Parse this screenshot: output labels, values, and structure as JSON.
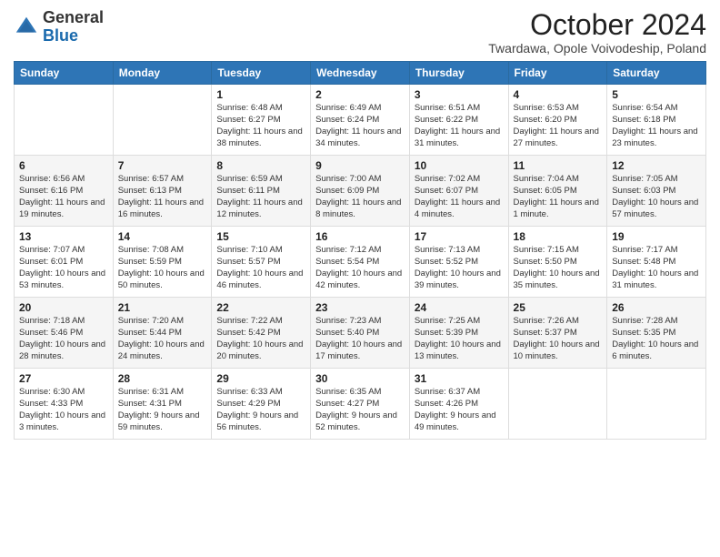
{
  "header": {
    "logo_general": "General",
    "logo_blue": "Blue",
    "month_title": "October 2024",
    "subtitle": "Twardawa, Opole Voivodeship, Poland"
  },
  "days_of_week": [
    "Sunday",
    "Monday",
    "Tuesday",
    "Wednesday",
    "Thursday",
    "Friday",
    "Saturday"
  ],
  "weeks": [
    [
      {
        "day": "",
        "info": ""
      },
      {
        "day": "",
        "info": ""
      },
      {
        "day": "1",
        "info": "Sunrise: 6:48 AM\nSunset: 6:27 PM\nDaylight: 11 hours and 38 minutes."
      },
      {
        "day": "2",
        "info": "Sunrise: 6:49 AM\nSunset: 6:24 PM\nDaylight: 11 hours and 34 minutes."
      },
      {
        "day": "3",
        "info": "Sunrise: 6:51 AM\nSunset: 6:22 PM\nDaylight: 11 hours and 31 minutes."
      },
      {
        "day": "4",
        "info": "Sunrise: 6:53 AM\nSunset: 6:20 PM\nDaylight: 11 hours and 27 minutes."
      },
      {
        "day": "5",
        "info": "Sunrise: 6:54 AM\nSunset: 6:18 PM\nDaylight: 11 hours and 23 minutes."
      }
    ],
    [
      {
        "day": "6",
        "info": "Sunrise: 6:56 AM\nSunset: 6:16 PM\nDaylight: 11 hours and 19 minutes."
      },
      {
        "day": "7",
        "info": "Sunrise: 6:57 AM\nSunset: 6:13 PM\nDaylight: 11 hours and 16 minutes."
      },
      {
        "day": "8",
        "info": "Sunrise: 6:59 AM\nSunset: 6:11 PM\nDaylight: 11 hours and 12 minutes."
      },
      {
        "day": "9",
        "info": "Sunrise: 7:00 AM\nSunset: 6:09 PM\nDaylight: 11 hours and 8 minutes."
      },
      {
        "day": "10",
        "info": "Sunrise: 7:02 AM\nSunset: 6:07 PM\nDaylight: 11 hours and 4 minutes."
      },
      {
        "day": "11",
        "info": "Sunrise: 7:04 AM\nSunset: 6:05 PM\nDaylight: 11 hours and 1 minute."
      },
      {
        "day": "12",
        "info": "Sunrise: 7:05 AM\nSunset: 6:03 PM\nDaylight: 10 hours and 57 minutes."
      }
    ],
    [
      {
        "day": "13",
        "info": "Sunrise: 7:07 AM\nSunset: 6:01 PM\nDaylight: 10 hours and 53 minutes."
      },
      {
        "day": "14",
        "info": "Sunrise: 7:08 AM\nSunset: 5:59 PM\nDaylight: 10 hours and 50 minutes."
      },
      {
        "day": "15",
        "info": "Sunrise: 7:10 AM\nSunset: 5:57 PM\nDaylight: 10 hours and 46 minutes."
      },
      {
        "day": "16",
        "info": "Sunrise: 7:12 AM\nSunset: 5:54 PM\nDaylight: 10 hours and 42 minutes."
      },
      {
        "day": "17",
        "info": "Sunrise: 7:13 AM\nSunset: 5:52 PM\nDaylight: 10 hours and 39 minutes."
      },
      {
        "day": "18",
        "info": "Sunrise: 7:15 AM\nSunset: 5:50 PM\nDaylight: 10 hours and 35 minutes."
      },
      {
        "day": "19",
        "info": "Sunrise: 7:17 AM\nSunset: 5:48 PM\nDaylight: 10 hours and 31 minutes."
      }
    ],
    [
      {
        "day": "20",
        "info": "Sunrise: 7:18 AM\nSunset: 5:46 PM\nDaylight: 10 hours and 28 minutes."
      },
      {
        "day": "21",
        "info": "Sunrise: 7:20 AM\nSunset: 5:44 PM\nDaylight: 10 hours and 24 minutes."
      },
      {
        "day": "22",
        "info": "Sunrise: 7:22 AM\nSunset: 5:42 PM\nDaylight: 10 hours and 20 minutes."
      },
      {
        "day": "23",
        "info": "Sunrise: 7:23 AM\nSunset: 5:40 PM\nDaylight: 10 hours and 17 minutes."
      },
      {
        "day": "24",
        "info": "Sunrise: 7:25 AM\nSunset: 5:39 PM\nDaylight: 10 hours and 13 minutes."
      },
      {
        "day": "25",
        "info": "Sunrise: 7:26 AM\nSunset: 5:37 PM\nDaylight: 10 hours and 10 minutes."
      },
      {
        "day": "26",
        "info": "Sunrise: 7:28 AM\nSunset: 5:35 PM\nDaylight: 10 hours and 6 minutes."
      }
    ],
    [
      {
        "day": "27",
        "info": "Sunrise: 6:30 AM\nSunset: 4:33 PM\nDaylight: 10 hours and 3 minutes."
      },
      {
        "day": "28",
        "info": "Sunrise: 6:31 AM\nSunset: 4:31 PM\nDaylight: 9 hours and 59 minutes."
      },
      {
        "day": "29",
        "info": "Sunrise: 6:33 AM\nSunset: 4:29 PM\nDaylight: 9 hours and 56 minutes."
      },
      {
        "day": "30",
        "info": "Sunrise: 6:35 AM\nSunset: 4:27 PM\nDaylight: 9 hours and 52 minutes."
      },
      {
        "day": "31",
        "info": "Sunrise: 6:37 AM\nSunset: 4:26 PM\nDaylight: 9 hours and 49 minutes."
      },
      {
        "day": "",
        "info": ""
      },
      {
        "day": "",
        "info": ""
      }
    ]
  ]
}
